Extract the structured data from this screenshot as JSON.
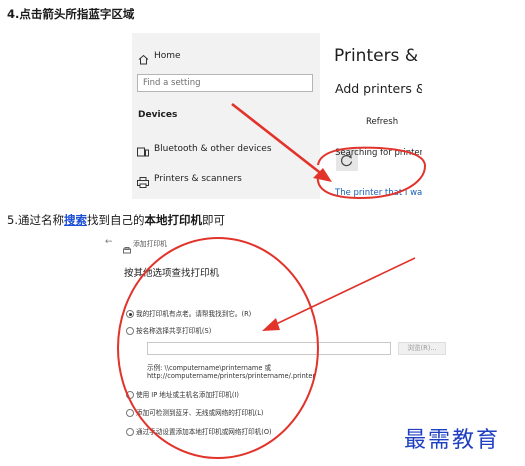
{
  "steps": {
    "step4": "4.点击箭头所指蓝字区域",
    "step5": {
      "prefix": "5.通过名称",
      "link": "搜索",
      "middle": "找到自己的",
      "bold": "本地打印机",
      "suffix": "即可"
    }
  },
  "shot1": {
    "sidebar": {
      "home": "Home",
      "search_placeholder": "Find a setting",
      "section": "Devices",
      "items": [
        {
          "label": "Bluetooth & other devices",
          "icon": "bluetooth-devices-icon"
        },
        {
          "label": "Printers & scanners",
          "icon": "printer-icon"
        }
      ]
    },
    "main": {
      "title": "Printers & sc",
      "subtitle": "Add printers & s",
      "refresh": "Refresh",
      "searching": "Searching for printers a",
      "link": "The printer that I want"
    }
  },
  "shot2": {
    "back": "←",
    "window_title": "添加打印机",
    "heading": "按其他选项查找打印机",
    "options": [
      {
        "label": "我的打印机有点老。请帮我找到它。(R)",
        "checked": true
      },
      {
        "label": "按名称选择共享打印机(S)",
        "checked": false
      },
      {
        "label": "使用 IP 地址或主机名添加打印机(I)",
        "checked": false
      },
      {
        "label": "添加可检测到蓝牙、无线或网络的打印机(L)",
        "checked": false
      },
      {
        "label": "通过手动设置添加本地打印机或网络打印机(O)",
        "checked": false
      }
    ],
    "browse": "浏览(R)...",
    "example_line1": "示例: \\\\computername\\printername 或",
    "example_line2": "http://computername/printers/printername/.printer"
  },
  "watermark": "最需教育",
  "colors": {
    "annotation_red": "#e2332b",
    "link_blue": "#1a5fb4",
    "watermark_blue": "#1f3fc2"
  }
}
